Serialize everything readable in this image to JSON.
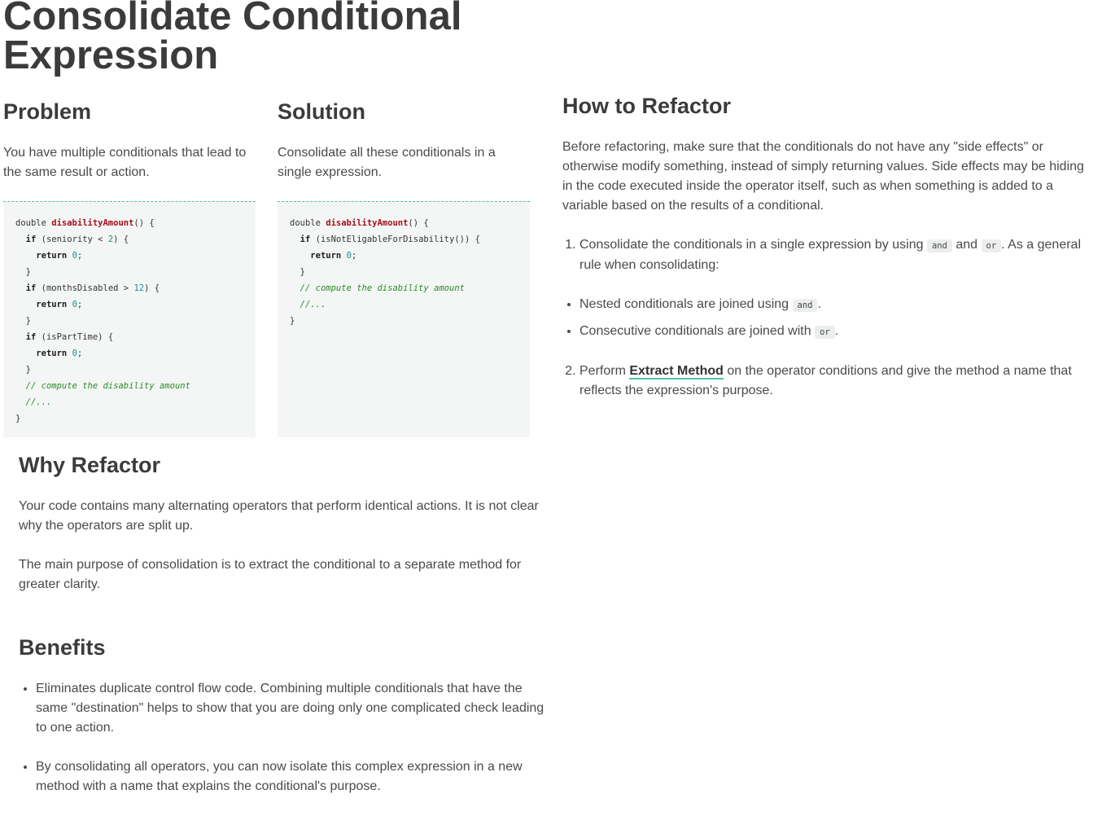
{
  "title": "Consolidate Conditional Expression",
  "problem": {
    "heading": "Problem",
    "text": "You have multiple conditionals that lead to the same result or action."
  },
  "solution": {
    "heading": "Solution",
    "text": "Consolidate all these conditionals in a single expression."
  },
  "how_to_refactor": {
    "heading": "How to Refactor",
    "intro": "Before refactoring, make sure that the conditionals do not have any \"side effects\" or otherwise modify something, instead of simply returning values. Side effects may be hiding in the code executed inside the operator itself, such as when something is added to a variable based on the results of a conditional.",
    "step1_pre": "Consolidate the conditionals in a single expression by using ",
    "step1_code_and": "and",
    "step1_mid": " and ",
    "step1_code_or": "or",
    "step1_post": ". As a general rule when consolidating:",
    "sub1_pre": "Nested conditionals are joined using ",
    "sub1_code": "and",
    "sub1_post": ".",
    "sub2_pre": "Consecutive conditionals are joined with ",
    "sub2_code": "or",
    "sub2_post": ".",
    "step2_pre": "Perform ",
    "step2_link": "Extract Method",
    "step2_post": " on the operator conditions and give the method a name that reflects the expression's purpose."
  },
  "why_refactor": {
    "heading": "Why Refactor",
    "p1": "Your code contains many alternating operators that perform identical actions. It is not clear why the operators are split up.",
    "p2": "The main purpose of consolidation is to extract the conditional to a separate method for greater clarity."
  },
  "benefits": {
    "heading": "Benefits",
    "items": [
      "Eliminates duplicate control flow code. Combining multiple conditionals that have the same \"destination\" helps to show that you are doing only one complicated check leading to one action.",
      "By consolidating all operators, you can now isolate this complex expression in a new method with a name that explains the conditional's purpose."
    ]
  },
  "code": {
    "double": "double",
    "method": "disabilityAmount",
    "parens_open": "() {",
    "if": "if",
    "return": "return",
    "zero": "0",
    "seniority": "(seniority < ",
    "two": "2",
    "cond_close": ") {",
    "months": "(monthsDisabled > ",
    "twelve": "12",
    "parttime": "(isPartTime) {",
    "noteligable": "(isNotEligableForDisability()) {",
    "comment1": "// compute the disability amount",
    "comment2": "//...",
    "close": "}",
    "semi": ";"
  }
}
